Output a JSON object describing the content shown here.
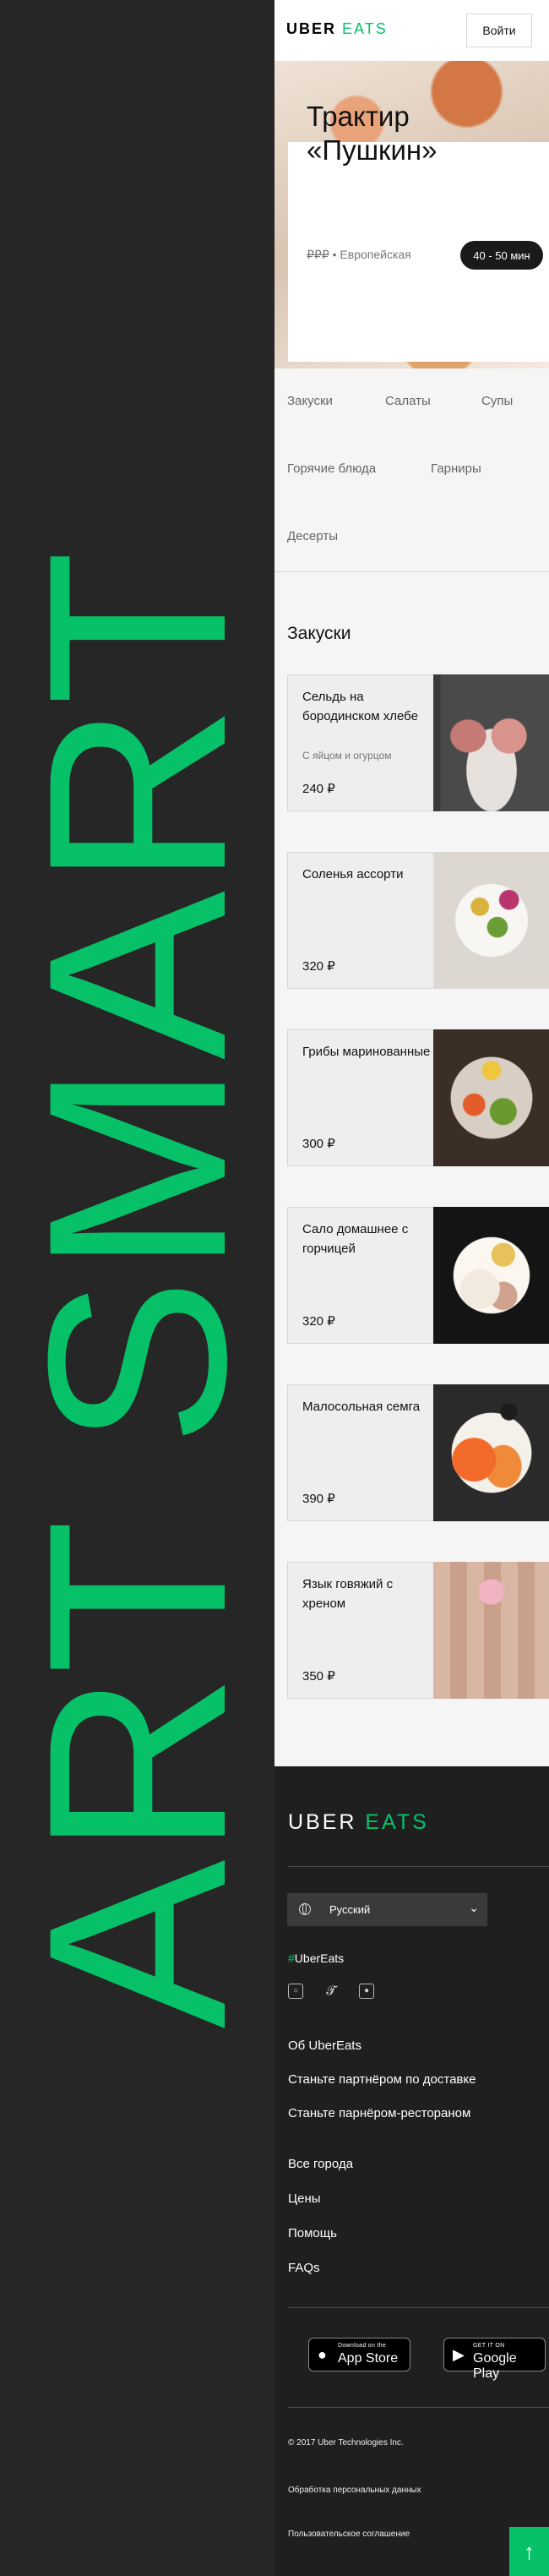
{
  "banner": {
    "text": "ART SMART"
  },
  "header": {
    "logo_main": "UBER",
    "logo_accent": "EATS",
    "login_label": "Войти"
  },
  "restaurant": {
    "name": "Трактир «Пушкин»",
    "price_level": "₽₽₽",
    "cuisine": "• Европейская",
    "delivery_time": "40 - 50 мин"
  },
  "categories": [
    "Закуски",
    "Салаты",
    "Супы",
    "Горячие блюда",
    "Гарниры",
    "Десерты"
  ],
  "section": {
    "title": "Закуски"
  },
  "menu": [
    {
      "name": "Сельдь на бородинском хлебе",
      "description": "С яйцом и огурцом",
      "price": "240 ₽"
    },
    {
      "name": "Соленья ассорти",
      "description": "",
      "price": "320 ₽"
    },
    {
      "name": "Грибы маринованные",
      "description": "",
      "price": "300 ₽"
    },
    {
      "name": "Сало домашнее с горчицей",
      "description": "",
      "price": "320 ₽"
    },
    {
      "name": "Малосольная семга",
      "description": "",
      "price": "390 ₽"
    },
    {
      "name": "Язык говяжий с хреном",
      "description": "",
      "price": "350 ₽"
    }
  ],
  "footer": {
    "logo_main": "UBER",
    "logo_accent": "EATS",
    "language": "Русский",
    "hashtag_symbol": "#",
    "hashtag_text": "UberEats",
    "links_primary": [
      "Об UberEats",
      "Станьте партнёром по доставке",
      "Станьте парнёром-рестораном"
    ],
    "links_secondary": [
      "Все города",
      "Цены",
      "Помощь",
      "FAQs"
    ],
    "app_store": {
      "small": "Download on the",
      "big": "App Store"
    },
    "google_play": {
      "small": "GET IT ON",
      "big": "Google Play"
    },
    "copyright": "© 2017 Uber Technologies Inc.",
    "privacy": "Обработка персональных данных",
    "terms": "Пользовательское соглашение"
  },
  "colors": {
    "accent": "#06c167",
    "dark": "#1f1f1f",
    "content_bg": "#f5f5f5"
  },
  "icons": [
    "globe-icon",
    "chevron-down-icon",
    "instagram-icon",
    "twitter-icon",
    "camera-icon",
    "apple-icon",
    "google-play-icon",
    "arrow-up-icon"
  ]
}
